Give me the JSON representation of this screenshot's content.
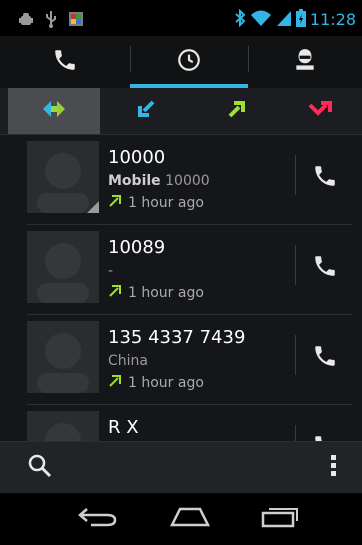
{
  "status": {
    "time": "11:28"
  },
  "tabs": [
    {
      "icon": "phone-icon"
    },
    {
      "icon": "clock-icon"
    },
    {
      "icon": "contacts-icon"
    }
  ],
  "filters": [
    {
      "icon": "all-calls-icon",
      "selected": true
    },
    {
      "icon": "incoming-call-icon",
      "color": "#33b5e5"
    },
    {
      "icon": "outgoing-call-icon",
      "color": "#9fdf2f"
    },
    {
      "icon": "missed-call-icon",
      "color": "#ff2a55"
    }
  ],
  "calls": [
    {
      "name": "10000",
      "type_label": "Mobile",
      "number": "10000",
      "detail": "",
      "time": "1 hour ago"
    },
    {
      "name": "10089",
      "type_label": "",
      "number": "",
      "detail": "-",
      "time": "1 hour ago"
    },
    {
      "name": "135 4337 7439",
      "type_label": "",
      "number": "",
      "detail": "China",
      "time": "1 hour ago"
    },
    {
      "name": "R X",
      "type_label": "",
      "number": "",
      "detail": "",
      "time": ""
    }
  ],
  "colors": {
    "accent": "#33b5e5",
    "outgoing": "#9fdf2f",
    "missed": "#ff2a55"
  }
}
